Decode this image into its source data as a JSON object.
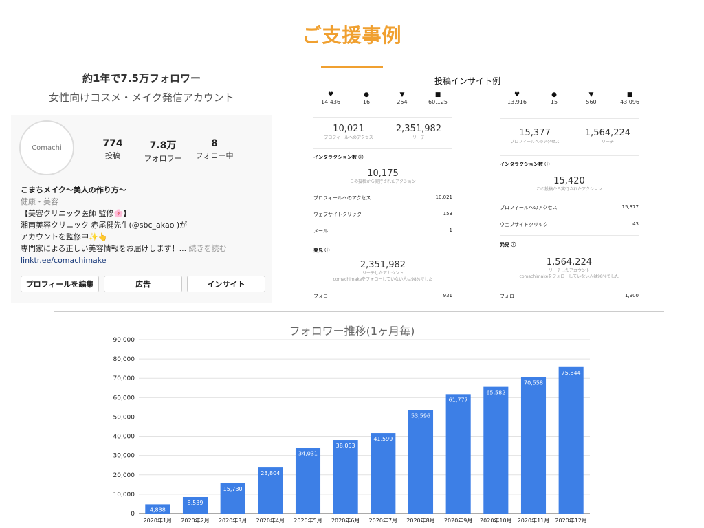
{
  "page": {
    "title": "ご支援事例",
    "accent_color": "#f0a030"
  },
  "left_panel": {
    "headline": "約1年で7.5万フォロワー",
    "subheadline": "女性向けコスメ・メイク発信アカウント",
    "profile": {
      "avatar_text": "Comachi",
      "stats": [
        {
          "value": "774",
          "label": "投稿"
        },
        {
          "value": "7.8万",
          "label": "フォロワー"
        },
        {
          "value": "8",
          "label": "フォロー中"
        }
      ],
      "name": "こまちメイク〜美人の作り方〜",
      "category": "健康・美容",
      "bio_lines": [
        "【美容クリニック医師 監修🌸】",
        "湘南美容クリニック 赤尾健先生(@sbc_akao )が",
        "アカウントを監修中✨👆"
      ],
      "bio_last_line": "専門家による正しい美容情報をお届けします！...",
      "more_label": "続きを読む",
      "link": "linktr.ee/comachimake",
      "buttons": [
        "プロフィールを編集",
        "広告",
        "インサイト"
      ]
    }
  },
  "insights": {
    "title": "投稿インサイト例",
    "panels": [
      {
        "counts": [
          {
            "icon": "heart-icon",
            "glyph": "♥",
            "value": "14,436"
          },
          {
            "icon": "comment-icon",
            "glyph": "●",
            "value": "16"
          },
          {
            "icon": "share-icon",
            "glyph": "▼",
            "value": "254"
          },
          {
            "icon": "bookmark-icon",
            "glyph": "■",
            "value": "60,125"
          }
        ],
        "profile_access": {
          "value": "10,021",
          "label": "プロフィールへのアクセス"
        },
        "reach": {
          "value": "2,351,982",
          "label": "リーチ"
        },
        "interaction_title": "インタラクション数 ⓘ",
        "interaction_value": "10,175",
        "interaction_label": "この投稿から実行されたアクション",
        "rows": [
          {
            "label": "プロフィールへのアクセス",
            "value": "10,021"
          },
          {
            "label": "ウェブサイトクリック",
            "value": "153"
          },
          {
            "label": "メール",
            "value": "1"
          }
        ],
        "discovery_title": "発見 ⓘ",
        "discovery_value": "2,351,982",
        "discovery_label": "リーチしたアカウント",
        "discovery_note": "comachimakeをフォローしていない人は98%でした",
        "follow_label": "フォロー",
        "follow_value": "931"
      },
      {
        "counts": [
          {
            "icon": "heart-icon",
            "glyph": "♥",
            "value": "13,916"
          },
          {
            "icon": "comment-icon",
            "glyph": "●",
            "value": "15"
          },
          {
            "icon": "share-icon",
            "glyph": "▼",
            "value": "560"
          },
          {
            "icon": "bookmark-icon",
            "glyph": "■",
            "value": "43,096"
          }
        ],
        "profile_access": {
          "value": "15,377",
          "label": "プロフィールへのアクセス"
        },
        "reach": {
          "value": "1,564,224",
          "label": "リーチ"
        },
        "interaction_title": "インタラクション数 ⓘ",
        "interaction_value": "15,420",
        "interaction_label": "この投稿から実行されたアクション",
        "rows": [
          {
            "label": "プロフィールへのアクセス",
            "value": "15,377"
          },
          {
            "label": "ウェブサイトクリック",
            "value": "43"
          }
        ],
        "discovery_title": "発見 ⓘ",
        "discovery_value": "1,564,224",
        "discovery_label": "リーチしたアカウント",
        "discovery_note": "comachimakeをフォローしていない人は98%でした",
        "follow_label": "フォロー",
        "follow_value": "1,900"
      }
    ]
  },
  "chart_data": {
    "type": "bar",
    "title": "フォロワー推移(1ヶ月毎)",
    "categories": [
      "2020年1月",
      "2020年2月",
      "2020年3月",
      "2020年4月",
      "2020年5月",
      "2020年6月",
      "2020年7月",
      "2020年8月",
      "2020年9月",
      "2020年10月",
      "2020年11月",
      "2020年12月"
    ],
    "values": [
      4838,
      8539,
      15730,
      23804,
      34031,
      38053,
      41599,
      53596,
      61777,
      65582,
      70558,
      75844
    ],
    "data_labels": [
      "4,838",
      "8,539",
      "15,730",
      "23,804",
      "34,031",
      "38,053",
      "41,599",
      "53,596",
      "61,777",
      "65,582",
      "70,558",
      "75,844"
    ],
    "yticks": [
      0,
      10000,
      20000,
      30000,
      40000,
      50000,
      60000,
      70000,
      80000,
      90000
    ],
    "ytick_labels": [
      "0",
      "10,000",
      "20,000",
      "30,000",
      "40,000",
      "50,000",
      "60,000",
      "70,000",
      "80,000",
      "90,000"
    ],
    "ylim": [
      0,
      90000
    ],
    "xlabel": "",
    "ylabel": "",
    "grid": true,
    "bar_color": "#3d7fe6"
  }
}
